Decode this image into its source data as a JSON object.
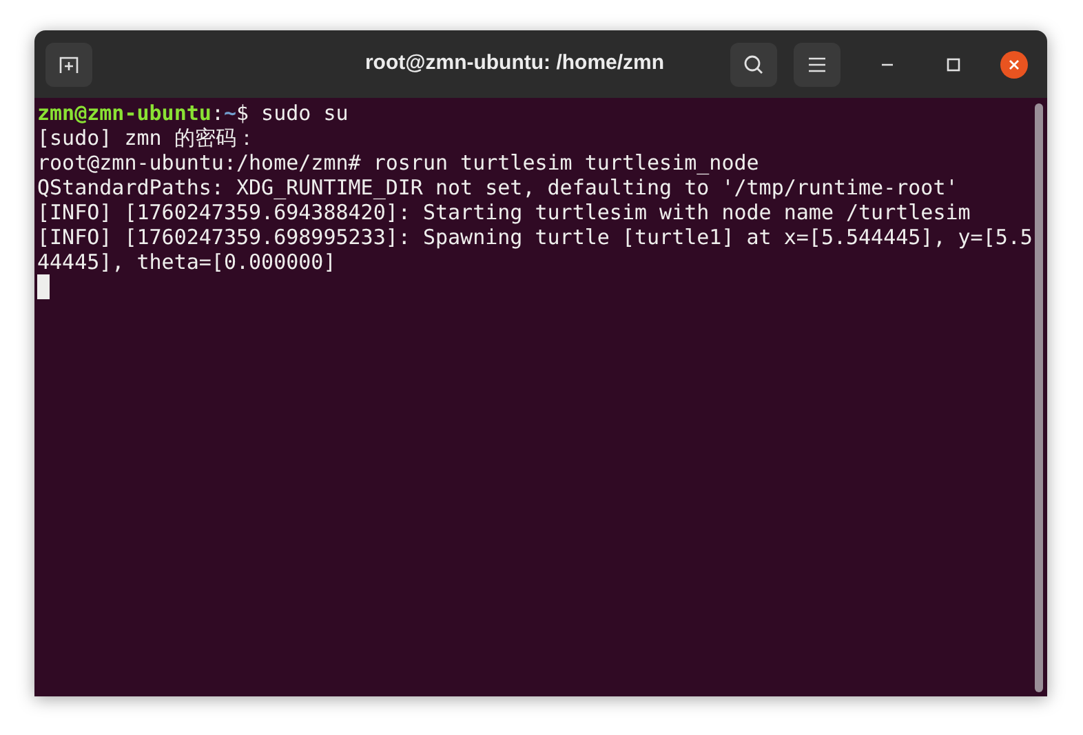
{
  "window": {
    "title": "root@zmn-ubuntu: /home/zmn"
  },
  "lines": [
    {
      "segments": [
        {
          "kind": "host",
          "text": "zmn@zmn-ubuntu"
        },
        {
          "kind": "plain",
          "text": ":"
        },
        {
          "kind": "path",
          "text": "~"
        },
        {
          "kind": "plain",
          "text": "$ sudo su"
        }
      ]
    },
    {
      "segments": [
        {
          "kind": "plain",
          "text": "[sudo] zmn 的密码："
        }
      ]
    },
    {
      "segments": [
        {
          "kind": "plain",
          "text": "root@zmn-ubuntu:/home/zmn# rosrun turtlesim turtlesim_node"
        }
      ]
    },
    {
      "segments": [
        {
          "kind": "plain",
          "text": "QStandardPaths: XDG_RUNTIME_DIR not set, defaulting to '/tmp/runtime-root'"
        }
      ]
    },
    {
      "segments": [
        {
          "kind": "plain",
          "text": "[INFO] [1760247359.694388420]: Starting turtlesim with node name /turtlesim"
        }
      ]
    },
    {
      "segments": [
        {
          "kind": "plain",
          "text": "[INFO] [1760247359.698995233]: Spawning turtle [turtle1] at x=[5.544445], y=[5.5"
        }
      ]
    },
    {
      "segments": [
        {
          "kind": "plain",
          "text": "44445], theta=[0.000000]"
        }
      ]
    }
  ],
  "cursor": {
    "visible": true
  }
}
